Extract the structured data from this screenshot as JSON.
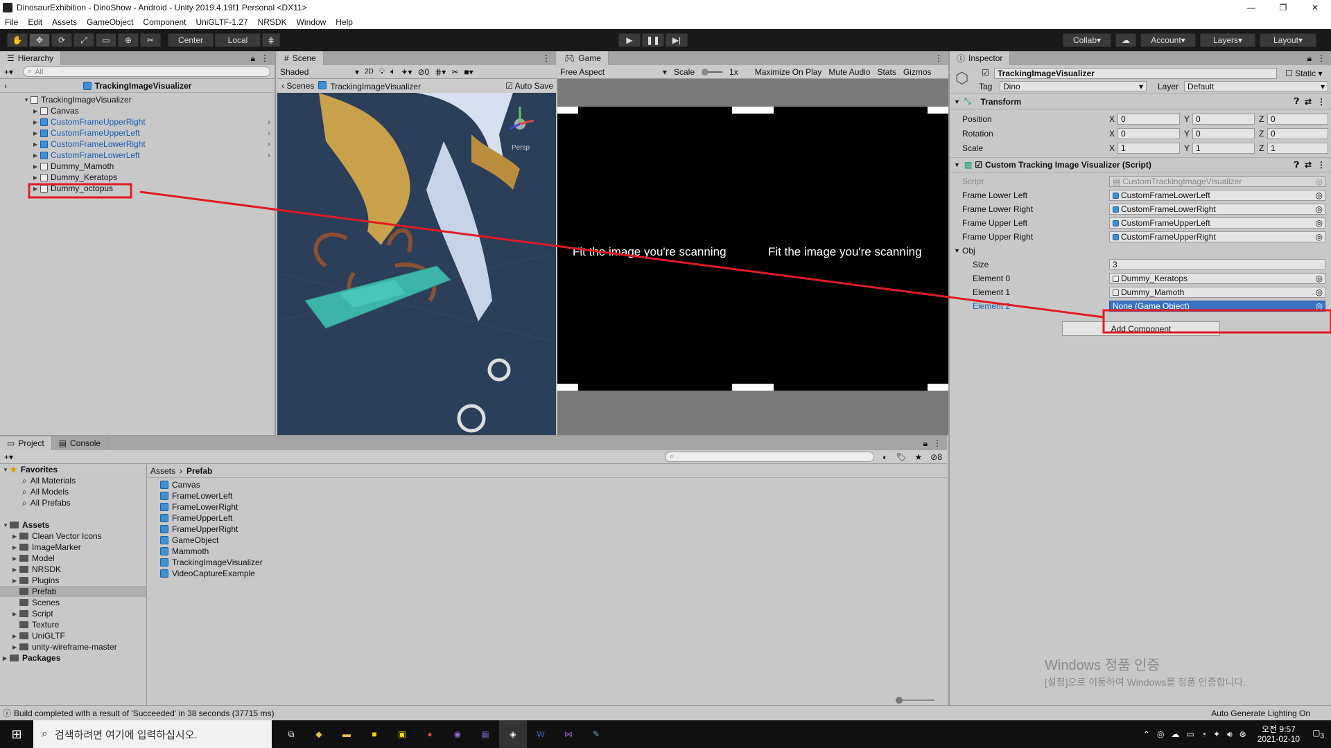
{
  "window": {
    "title": "DinosaurExhibition - DinoShow - Android - Unity 2019.4.19f1 Personal <DX11>"
  },
  "menu": [
    "File",
    "Edit",
    "Assets",
    "GameObject",
    "Component",
    "UniGLTF-1.27",
    "NRSDK",
    "Window",
    "Help"
  ],
  "toolbar": {
    "center": "Center",
    "local": "Local",
    "collab": "Collab",
    "account": "Account",
    "layers": "Layers",
    "layout": "Layout"
  },
  "hierarchy": {
    "tab": "Hierarchy",
    "search_placeholder": "All",
    "context_title": "TrackingImageVisualizer",
    "items": [
      {
        "label": "TrackingImageVisualizer",
        "depth": 0,
        "blue": false
      },
      {
        "label": "Canvas",
        "depth": 1,
        "blue": false
      },
      {
        "label": "CustomFrameUpperRight",
        "depth": 1,
        "blue": true
      },
      {
        "label": "CustomFrameUpperLeft",
        "depth": 1,
        "blue": true
      },
      {
        "label": "CustomFrameLowerRight",
        "depth": 1,
        "blue": true
      },
      {
        "label": "CustomFrameLowerLeft",
        "depth": 1,
        "blue": true
      },
      {
        "label": "Dummy_Mamoth",
        "depth": 1,
        "blue": false
      },
      {
        "label": "Dummy_Keratops",
        "depth": 1,
        "blue": false
      },
      {
        "label": "Dummy_octopus",
        "depth": 1,
        "blue": false
      }
    ]
  },
  "scene": {
    "tab": "Scene",
    "shading": "Shaded",
    "mode_2d": "2D",
    "hidden_count": "0",
    "breadcrumb_root": "Scenes",
    "breadcrumb_item": "TrackingImageVisualizer",
    "auto_save": "Auto Save",
    "persp": "Persp"
  },
  "game": {
    "tab": "Game",
    "aspect": "Free Aspect",
    "scale_label": "Scale",
    "scale_value": "1x",
    "maximize": "Maximize On Play",
    "mute": "Mute Audio",
    "stats": "Stats",
    "gizmos": "Gizmos",
    "overlay_text_left": "Fit the image you're scanning",
    "overlay_text_right": "Fit the image you're scanning"
  },
  "inspector": {
    "tab": "Inspector",
    "object_name": "TrackingImageVisualizer",
    "static_label": "Static",
    "tag_label": "Tag",
    "tag_value": "Dino",
    "layer_label": "Layer",
    "layer_value": "Default",
    "transform": {
      "title": "Transform",
      "rows": [
        {
          "label": "Position",
          "x": "0",
          "y": "0",
          "z": "0"
        },
        {
          "label": "Rotation",
          "x": "0",
          "y": "0",
          "z": "0"
        },
        {
          "label": "Scale",
          "x": "1",
          "y": "1",
          "z": "1"
        }
      ]
    },
    "script_component": {
      "title": "Custom Tracking Image Visualizer (Script)",
      "script_label": "Script",
      "script_value": "CustomTrackingImageVisualizer",
      "frames": [
        {
          "label": "Frame Lower Left",
          "value": "CustomFrameLowerLeft"
        },
        {
          "label": "Frame Lower Right",
          "value": "CustomFrameLowerRight"
        },
        {
          "label": "Frame Upper Left",
          "value": "CustomFrameUpperLeft"
        },
        {
          "label": "Frame Upper Right",
          "value": "CustomFrameUpperRight"
        }
      ],
      "obj_label": "Obj",
      "size_label": "Size",
      "size_value": "3",
      "elements": [
        {
          "label": "Element 0",
          "value": "Dummy_Keratops"
        },
        {
          "label": "Element 1",
          "value": "Dummy_Mamoth"
        },
        {
          "label": "Element 2",
          "value": "None (Game Object)"
        }
      ]
    },
    "add_component": "Add Component"
  },
  "project": {
    "tab_project": "Project",
    "tab_console": "Console",
    "hidden_count": "8",
    "favorites": {
      "label": "Favorites",
      "items": [
        "All Materials",
        "All Models",
        "All Prefabs"
      ]
    },
    "assets": {
      "label": "Assets",
      "items": [
        "Clean Vector Icons",
        "ImageMarker",
        "Model",
        "NRSDK",
        "Plugins",
        "Prefab",
        "Scenes",
        "Script",
        "Texture",
        "UniGLTF",
        "unity-wireframe-master"
      ]
    },
    "packages": "Packages",
    "breadcrumb": [
      "Assets",
      "Prefab"
    ],
    "files": [
      "Canvas",
      "FrameLowerLeft",
      "FrameLowerRight",
      "FrameUpperLeft",
      "FrameUpperRight",
      "GameObject",
      "Mammoth",
      "TrackingImageVisualizer",
      "VideoCaptureExample"
    ]
  },
  "watermark": {
    "line1": "Windows 정품 인증",
    "line2": "[설정]으로 이동하여 Windows를 정품 인증합니다."
  },
  "status": {
    "message": "Build completed with a result of 'Succeeded' in 38 seconds (37715 ms)",
    "right": "Auto Generate Lighting On"
  },
  "taskbar": {
    "search_placeholder": "검색하려면 여기에 입력하십시오.",
    "time": "오전 9:57",
    "date": "2021-02-10",
    "notif_count": "3"
  }
}
